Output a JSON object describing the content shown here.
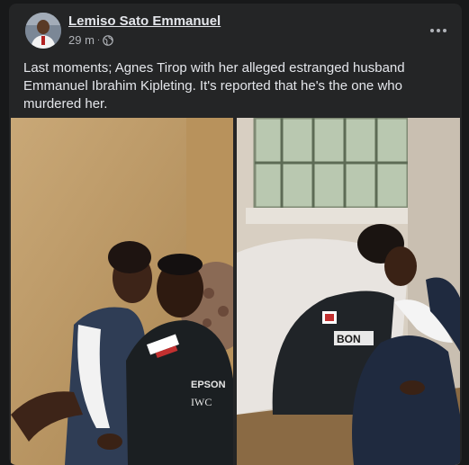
{
  "post": {
    "author": "Lemiso Sato Emmanuel",
    "time": "29 m",
    "separator": "·",
    "privacy_icon": "globe-icon",
    "more_icon": "more-options-icon",
    "caption": "Last moments; Agnes Tirop with her alleged estranged husband Emmanuel Ibrahim Kipleting. It's reported that he's the one who murdered her."
  },
  "photos": {
    "right_shirt_text": "BON",
    "left_logos": [
      "EPSON",
      "IWC"
    ]
  },
  "colors": {
    "background": "#18191a",
    "card": "#242526",
    "text_primary": "#e4e6eb",
    "text_secondary": "#b0b3b8"
  }
}
